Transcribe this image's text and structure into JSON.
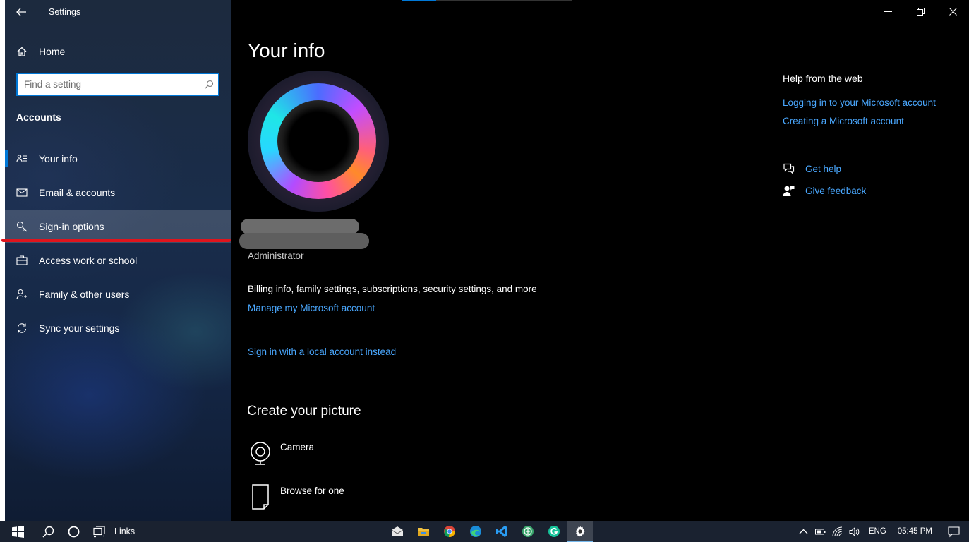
{
  "window": {
    "title": "Settings",
    "accent": "#0078d7",
    "link_color": "#4aa8ff",
    "progress": 0.2
  },
  "sidebar": {
    "home_label": "Home",
    "search_placeholder": "Find a setting",
    "section_title": "Accounts",
    "items": [
      {
        "label": "Your info",
        "icon": "person-card-icon",
        "selected": true
      },
      {
        "label": "Email & accounts",
        "icon": "envelope-icon"
      },
      {
        "label": "Sign-in options",
        "icon": "key-icon",
        "hovered": true
      },
      {
        "label": "Access work or school",
        "icon": "briefcase-icon"
      },
      {
        "label": "Family & other users",
        "icon": "person-add-icon"
      },
      {
        "label": "Sync your settings",
        "icon": "sync-icon"
      }
    ],
    "annotation_color": "#e0141c"
  },
  "main": {
    "page_title": "Your info",
    "role": "Administrator",
    "billing_text": "Billing info, family settings, subscriptions, security settings, and more",
    "manage_link": "Manage my Microsoft account",
    "local_link": "Sign in with a local account instead",
    "create_title": "Create your picture",
    "camera_label": "Camera",
    "browse_label": "Browse for one"
  },
  "help": {
    "title": "Help from the web",
    "links": [
      "Logging in to your Microsoft account",
      "Creating a Microsoft account"
    ],
    "get_help": "Get help",
    "give_feedback": "Give feedback"
  },
  "taskbar": {
    "links_label": "Links",
    "apps": [
      "mail-icon",
      "file-explorer-icon",
      "chrome-icon",
      "edge-icon",
      "vscode-icon",
      "app-icon",
      "grammarly-icon",
      "settings-gear-icon"
    ],
    "language": "ENG",
    "time": "05:45 PM"
  }
}
